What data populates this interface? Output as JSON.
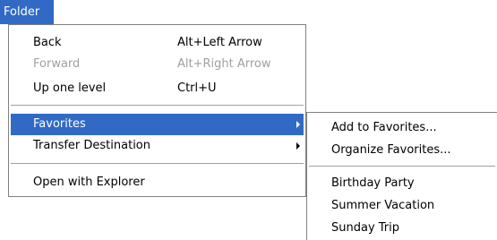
{
  "menu_title": "Folder",
  "main_menu": {
    "back": {
      "label": "Back",
      "shortcut": "Alt+Left Arrow"
    },
    "forward": {
      "label": "Forward",
      "shortcut": "Alt+Right Arrow",
      "disabled": true
    },
    "up_one_level": {
      "label": "Up one level",
      "shortcut": "Ctrl+U"
    },
    "favorites": {
      "label": "Favorites",
      "highlighted": true
    },
    "transfer_destination": {
      "label": "Transfer Destination"
    },
    "open_with_explorer": {
      "label": "Open with Explorer"
    }
  },
  "favorites_submenu": {
    "add_to_favorites": "Add to Favorites...",
    "organize_favorites": "Organize Favorites...",
    "items": [
      "Birthday Party",
      "Summer Vacation",
      "Sunday Trip"
    ]
  },
  "colors": {
    "highlight": "#316ac5",
    "disabled_text": "#a0a0a0",
    "border": "#808080"
  }
}
